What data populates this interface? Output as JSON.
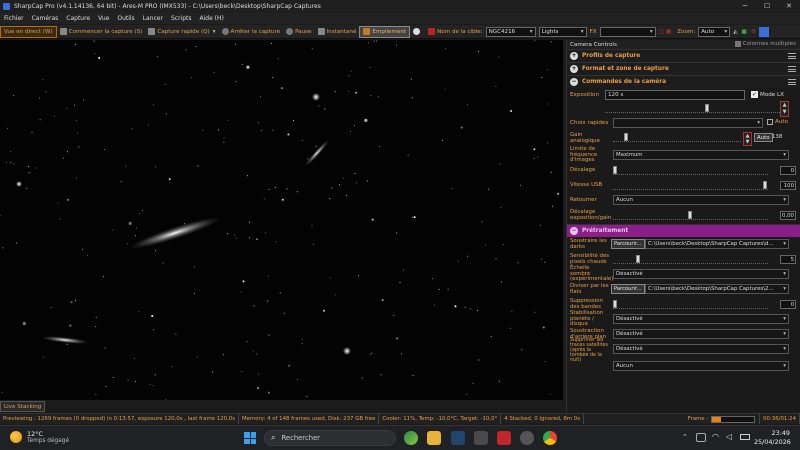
{
  "window": {
    "title": "SharpCap Pro (v4.1.14136, 64 bit) - Ares-M PRO (IMX533) - C:\\Users\\beck\\Desktop\\SharpCap Captures"
  },
  "menu": [
    "Fichier",
    "Caméras",
    "Capture",
    "Vue",
    "Outils",
    "Lancer",
    "Scripts",
    "Aide (H)"
  ],
  "toolbar": {
    "live": "Vue en direct (W)",
    "start": "Commencer la capture (S)",
    "quick": "Capture rapide (Q)",
    "stop": "Arrêter la capture",
    "pause": "Pause",
    "snapshot": "Instantané",
    "stack": "Empilement",
    "target_label": "Nom de la cible:",
    "target_value": "NGC4216",
    "frame_type": "Lights",
    "fx": "FX",
    "zoom_label": "Zoom:",
    "zoom_value": "Auto"
  },
  "sidebar": {
    "title": "Camera Controls",
    "multi_cols": "Colonnes multiples",
    "sections": {
      "profiles": "Profils de capture",
      "format": "Format et zone de capture",
      "camera": "Commandes de la caméra",
      "preprocess": "Prétraitement"
    },
    "camera": {
      "exposure_label": "Exposition",
      "exposure_value": "120 s",
      "lx_mode": "Mode LX",
      "quick_picks": "Choix rapides",
      "auto": "Auto",
      "gain_label": "Gain analogique",
      "gain_auto": "Auto",
      "gain_value": "138",
      "gain_level": 0.09,
      "framerate_label": "Limite de fréquence d'images",
      "framerate_value": "Maximum",
      "offset_label": "Décalage",
      "offset_value": "0",
      "offset_level": 0,
      "usb_label": "Vitesse USB",
      "usb_value": "100",
      "usb_level": 1,
      "flip_label": "Retourner",
      "flip_value": "Aucun",
      "expo_offset_label": "Décalage exposition/gain",
      "expo_offset_value": "0,00",
      "expo_offset_level": 0.5
    },
    "pre": {
      "darks_label": "Soustraire les darks",
      "browse": "Parcourir...",
      "darks_path": "C:\\Users\\beck\\Desktop\\SharpCap Captures\\d...",
      "hotpix_label": "Sensibilité des pixels chauds",
      "hotpix_value": "5",
      "hotpix_level": 0.15,
      "dark_scale_label": "Échelle sombre (expérimentale)",
      "dark_scale_value": "Désactivé",
      "flats_label": "Diviser par les flats",
      "flats_path": "C:\\Users\\beck\\Desktop\\SharpCap Captures\\2...",
      "banding_label": "Suppression des bandes",
      "banding_value": "0",
      "banding_level": 0,
      "stab_label": "Stabilisation planète / disque",
      "stab_value": "Désactivé",
      "bg_label": "Soustraction d'arrière plan",
      "bg_value": "Désactivé",
      "sat_label": "Supprimer les traces satellites (après la tombée de la nuit)",
      "sat_value": "Désactivé",
      "last_value": "Aucun"
    }
  },
  "live_stacking_btn": "Live Stacking",
  "status": {
    "previewing": "Previewing : 1269 frames (0 dropped) in 0:13:57, exposure 120,0s , last frame 120,0s",
    "memory": "Memory: 4 of 148 frames used, Disk: 237 GB free",
    "cooler": "Cooler: 11%, Temp: -10,0°C, Target: -10,0°",
    "stacked": "4 Stacked, 0 Ignored, 8m 0s",
    "frame_label": "Frame :",
    "frame_progress": 0.2,
    "time": "00:36/01:24"
  },
  "taskbar": {
    "weather_temp": "12°C",
    "weather_desc": "Temps dégagé",
    "search": "Rechercher",
    "clock_time": "23:49",
    "clock_date": "25/04/2026"
  },
  "colors": {
    "accent": "#e6a04a",
    "purple": "#8a1f8a"
  }
}
